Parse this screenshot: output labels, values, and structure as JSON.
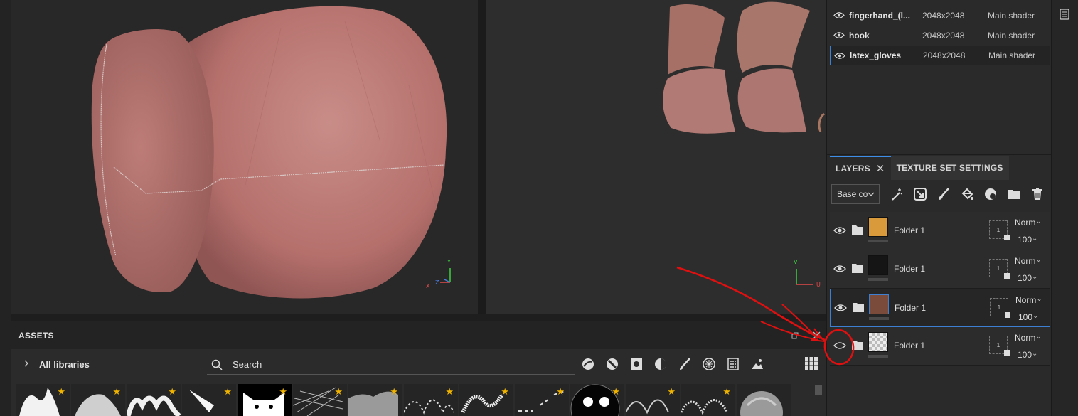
{
  "viewport3d": {
    "axis_y": "Y",
    "axis_x": "X",
    "axis_z": "Z"
  },
  "viewport2d": {
    "axis_v": "V",
    "axis_u": "U"
  },
  "assets": {
    "title": "ASSETS",
    "library_label": "All libraries",
    "search_placeholder": "Search",
    "thumbnails_count_note": "",
    "star": "★"
  },
  "texture_sets": [
    {
      "name": "fingerhand_(l...",
      "resolution": "2048x2048",
      "shader": "Main shader",
      "selected": false
    },
    {
      "name": "hook",
      "resolution": "2048x2048",
      "shader": "Main shader",
      "selected": false
    },
    {
      "name": "latex_gloves",
      "resolution": "2048x2048",
      "shader": "Main shader",
      "selected": true
    }
  ],
  "tabs": {
    "layers": "LAYERS",
    "texture_set_settings": "TEXTURE SET SETTINGS"
  },
  "channel_select": "Base co",
  "layers": [
    {
      "name": "Folder 1",
      "blend": "Norm",
      "opacity": "100",
      "mask_num": "1",
      "visible": true,
      "thumb_color": "#d99a3c",
      "selected": false
    },
    {
      "name": "Folder 1",
      "blend": "Norm",
      "opacity": "100",
      "mask_num": "1",
      "visible": true,
      "thumb_color": "#151515",
      "selected": false
    },
    {
      "name": "Folder 1",
      "blend": "Norm",
      "opacity": "100",
      "mask_num": "1",
      "visible": true,
      "thumb_color": "#7a4a3a",
      "selected": true
    },
    {
      "name": "Folder 1",
      "blend": "Norm",
      "opacity": "100",
      "mask_num": "1",
      "visible": false,
      "thumb_color": "#e8e8e8",
      "selected": false
    }
  ],
  "colors": {
    "accent": "#3d7fd3",
    "annotation": "#e01010",
    "star": "#f0b400",
    "skin": "#c47f7b"
  }
}
